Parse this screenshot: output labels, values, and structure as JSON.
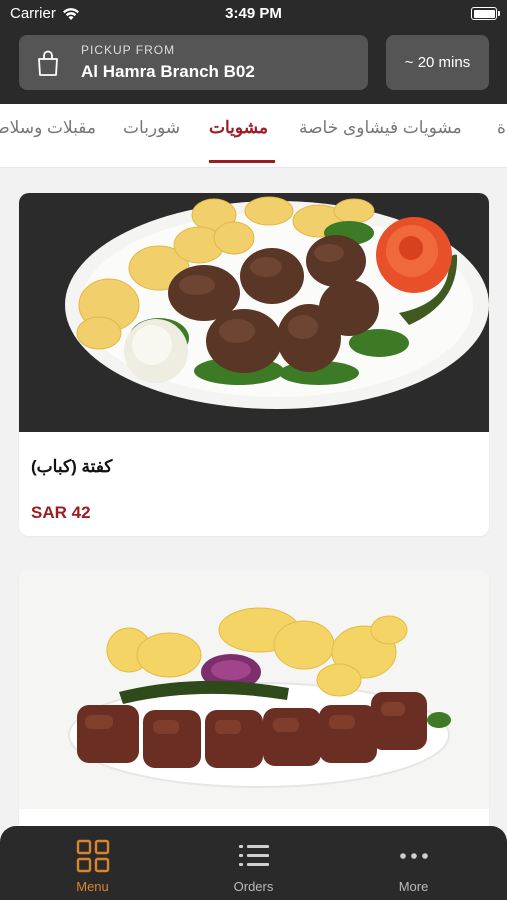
{
  "status": {
    "carrier": "Carrier",
    "time": "3:49 PM"
  },
  "pickup": {
    "label": "PICKUP FROM",
    "branch": "Al Hamra Branch B02"
  },
  "eta": "~ 20 mins",
  "tabs": [
    {
      "label": "مقبلات وسلاطات"
    },
    {
      "label": "شوربات"
    },
    {
      "label": "مشويات",
      "active": true
    },
    {
      "label": "مشويات فيشاوى خاصة"
    },
    {
      "label": "ة"
    }
  ],
  "menu_items": [
    {
      "name": "كفتة (كباب)",
      "price": "SAR 42",
      "image": "kofta-kebab-plate"
    },
    {
      "name": "",
      "price": "",
      "image": "grilled-meat-plate"
    }
  ],
  "tabbar": [
    {
      "label": "Menu",
      "icon": "grid-icon",
      "active": true
    },
    {
      "label": "Orders",
      "icon": "list-icon"
    },
    {
      "label": "More",
      "icon": "more-icon"
    }
  ],
  "colors": {
    "accent": "#9e1b25",
    "tabbar_active": "#d9842e",
    "header_bg": "#2a2a2a"
  }
}
